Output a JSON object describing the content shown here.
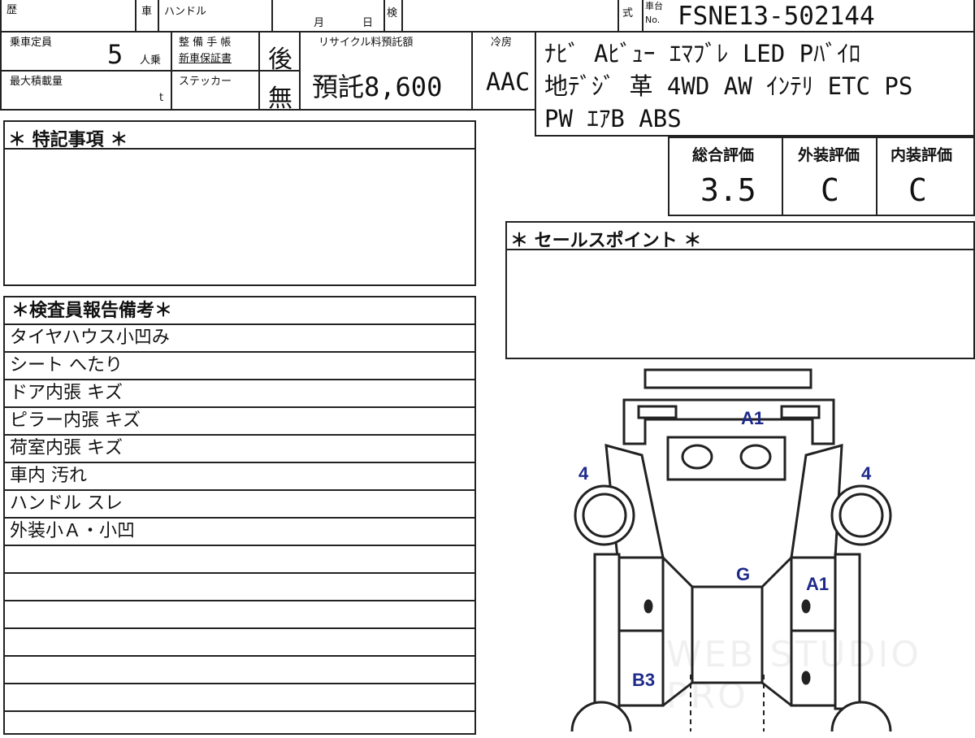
{
  "header": {
    "reki_label": "歴",
    "sha_label": "車",
    "handle_label": "ハンドル",
    "month_label": "月",
    "day_label": "日",
    "ken_label": "検",
    "shiki_label": "式",
    "chassis_label_top": "車台",
    "chassis_label_no": "No.",
    "chassis_number": "FSNE13-502144"
  },
  "info": {
    "capacity_label": "乗車定員",
    "capacity_value": "5",
    "capacity_unit": "人乗",
    "max_load_label": "最大積載量",
    "max_load_unit": "t",
    "maintenance_label_1": "整 備 手 帳",
    "maintenance_label_2": "新車保証書",
    "maintenance_value": "後",
    "sticker_label": "ステッカー",
    "sticker_value": "無",
    "recycle_label": "リサイクル料預託額",
    "recycle_value": "預託8,600",
    "aircon_label": "冷房",
    "aircon_value": "AAC",
    "equipment_lines": [
      "ﾅﾋﾞ Aﾋﾞｭｰ ｴﾏﾌﾞﾚ LED Pﾊﾞｲﾛ",
      "地ﾃﾞｼﾞ 革 4WD AW ｲﾝﾃﾘ ETC PS",
      "PW ｴｱB ABS"
    ]
  },
  "ratings": {
    "overall_label": "総合評価",
    "overall_value": "3.5",
    "exterior_label": "外装評価",
    "exterior_value": "C",
    "interior_label": "内装評価",
    "interior_value": "C"
  },
  "special_notes": {
    "title": "＊ 特記事項 ＊"
  },
  "sales_points": {
    "title": "＊ セールスポイント ＊"
  },
  "inspector_report": {
    "title": "＊検査員報告備考＊",
    "rows": [
      "タイヤハウス小凹み",
      "シート へたり",
      "ドア内張 キズ",
      "ピラー内張 キズ",
      "荷室内張 キズ",
      "車内 汚れ",
      "ハンドル スレ",
      "外装小Ａ・小凹",
      "",
      "",
      "",
      "",
      "",
      "",
      ""
    ]
  },
  "car_diagram": {
    "marks": [
      "A1",
      "4",
      "4",
      "G",
      "A1",
      "B3"
    ]
  },
  "watermark": "WEB STUDIO PRO",
  "colors": {
    "ink": "#222222",
    "mark": "#1d2a8a"
  }
}
